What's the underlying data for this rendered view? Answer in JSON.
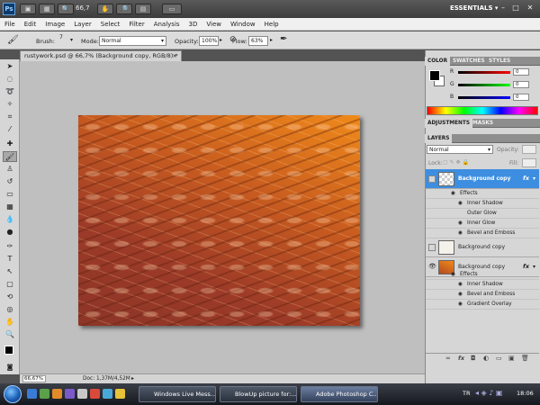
{
  "appbar": {
    "logo": "Ps",
    "zoom": "66,7",
    "workspace": "ESSENTIALS ▾",
    "win_min": "–",
    "win_max": "□",
    "win_close": "✕"
  },
  "menu": [
    "File",
    "Edit",
    "Image",
    "Layer",
    "Select",
    "Filter",
    "Analysis",
    "3D",
    "View",
    "Window",
    "Help"
  ],
  "options": {
    "brush_label": "Brush:",
    "brush_size": "7",
    "mode_label": "Mode:",
    "mode_value": "Normal",
    "opacity_label": "Opacity:",
    "opacity_value": "100%",
    "flow_label": "Flow:",
    "flow_value": "63%"
  },
  "document": {
    "tab_title": "rustywork.psd @ 66,7% (Background copy, RGB/8) *",
    "tab_close": "×",
    "zoom_status": "66,67%",
    "doc_status": "Doc: 1,37M/4,52M"
  },
  "color_panel": {
    "tabs": [
      "COLOR",
      "SWATCHES",
      "STYLES"
    ],
    "r_label": "R",
    "g_label": "G",
    "b_label": "B",
    "r_value": "0",
    "g_value": "0",
    "b_value": "0"
  },
  "adjust_panel": {
    "tabs": [
      "ADJUSTMENTS",
      "MASKS"
    ]
  },
  "layers_panel": {
    "tab": "LAYERS",
    "blend_mode": "Normal",
    "opacity_label": "Opacity:",
    "lock_label": "Lock:",
    "fill_label": "Fill:",
    "layers": [
      {
        "name": "Background copy",
        "selected": true,
        "visible": false,
        "fx": "fx",
        "effects_title": "Effects",
        "effects": [
          {
            "name": "Inner Shadow",
            "visible": true
          },
          {
            "name": "Outer Glow",
            "visible": false
          },
          {
            "name": "Inner Glow",
            "visible": true
          },
          {
            "name": "Bevel and Emboss",
            "visible": true
          }
        ]
      },
      {
        "name": "Background copy",
        "selected": false,
        "visible": false,
        "fx": "",
        "effects": []
      },
      {
        "name": "Background copy",
        "selected": false,
        "visible": true,
        "fx": "fx",
        "effects_title": "Effects",
        "effects": [
          {
            "name": "Inner Shadow",
            "visible": true
          },
          {
            "name": "Bevel and Emboss",
            "visible": true
          },
          {
            "name": "Gradient Overlay",
            "visible": true
          }
        ]
      }
    ]
  },
  "taskbar": {
    "buttons": [
      {
        "label": "Windows Live Mess..."
      },
      {
        "label": "BlowUp picture for:..."
      },
      {
        "label": "Adobe Photoshop C..."
      }
    ],
    "lang": "TR",
    "clock": "18:06"
  },
  "colors": {
    "selected_layer": "#3d8ee0",
    "accent_orange": "#f08a1a",
    "canvas_bg": "#bfbfbf"
  }
}
